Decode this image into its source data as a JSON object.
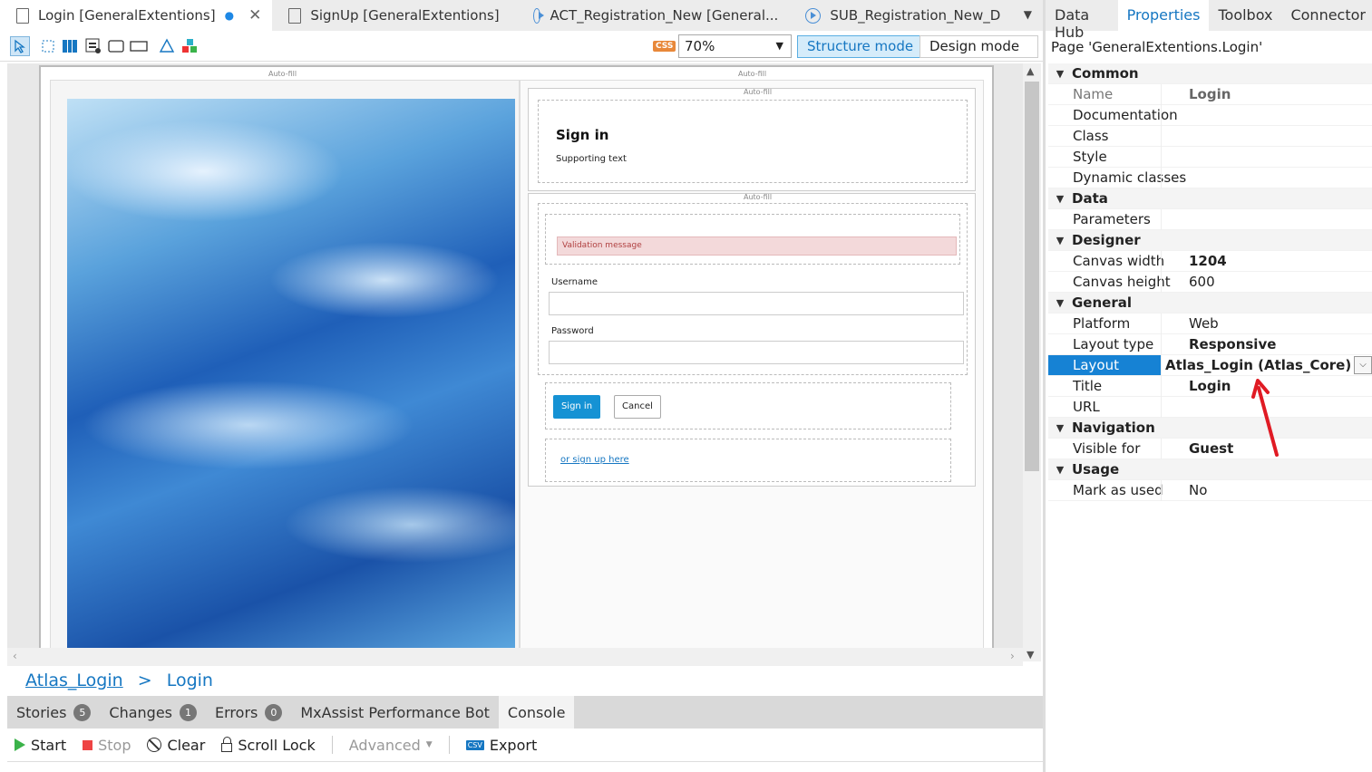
{
  "tabs": [
    {
      "label": "Login [GeneralExtentions]",
      "active": true,
      "modified": true
    },
    {
      "label": "SignUp [GeneralExtentions]",
      "active": false
    },
    {
      "label": "ACT_Registration_New [General...",
      "active": false
    },
    {
      "label": "SUB_Registration_New_D",
      "active": false
    }
  ],
  "toolbar": {
    "zoom": "70%",
    "css_label": "CSS",
    "structure_mode": "Structure mode",
    "design_mode": "Design mode"
  },
  "canvas": {
    "autofill": "Auto-fill",
    "signin_title": "Sign in",
    "supporting_text": "Supporting text",
    "validation_message": "Validation message",
    "username_label": "Username",
    "password_label": "Password",
    "signin_button": "Sign in",
    "cancel_button": "Cancel",
    "signup_link": "or sign up here"
  },
  "breadcrumb": {
    "layout": "Atlas_Login",
    "separator": ">",
    "page": "Login"
  },
  "bottom_tabs": [
    {
      "label": "Stories",
      "count": "5"
    },
    {
      "label": "Changes",
      "count": "1"
    },
    {
      "label": "Errors",
      "count": "0"
    },
    {
      "label": "MxAssist Performance Bot"
    },
    {
      "label": "Console",
      "active": true
    }
  ],
  "console": {
    "start": "Start",
    "stop": "Stop",
    "clear": "Clear",
    "scroll_lock": "Scroll Lock",
    "advanced": "Advanced",
    "export": "Export",
    "csv_label": "CSV"
  },
  "right_tabs": [
    "Data Hub",
    "Properties",
    "Toolbox",
    "Connector"
  ],
  "properties": {
    "page_label": "Page 'GeneralExtentions.Login'",
    "categories": {
      "common": "Common",
      "data": "Data",
      "designer": "Designer",
      "general": "General",
      "navigation": "Navigation",
      "usage": "Usage"
    },
    "name": {
      "label": "Name",
      "value": "Login"
    },
    "documentation": {
      "label": "Documentation",
      "value": ""
    },
    "class": {
      "label": "Class",
      "value": ""
    },
    "style": {
      "label": "Style",
      "value": ""
    },
    "dynamic_classes": {
      "label": "Dynamic classes",
      "value": ""
    },
    "parameters": {
      "label": "Parameters",
      "value": ""
    },
    "canvas_width": {
      "label": "Canvas width",
      "value": "1204"
    },
    "canvas_height": {
      "label": "Canvas height",
      "value": "600"
    },
    "platform": {
      "label": "Platform",
      "value": "Web"
    },
    "layout_type": {
      "label": "Layout type",
      "value": "Responsive"
    },
    "layout": {
      "label": "Layout",
      "value": "Atlas_Login (Atlas_Core)"
    },
    "title": {
      "label": "Title",
      "value": "Login"
    },
    "url": {
      "label": "URL",
      "value": ""
    },
    "visible_for": {
      "label": "Visible for",
      "value": "Guest"
    },
    "mark_as_used": {
      "label": "Mark as used",
      "value": "No"
    }
  },
  "colors": {
    "accent": "#1677c2",
    "selection": "#1682d4",
    "primary_button": "#1592d4",
    "annotation_arrow": "#e01b24"
  }
}
